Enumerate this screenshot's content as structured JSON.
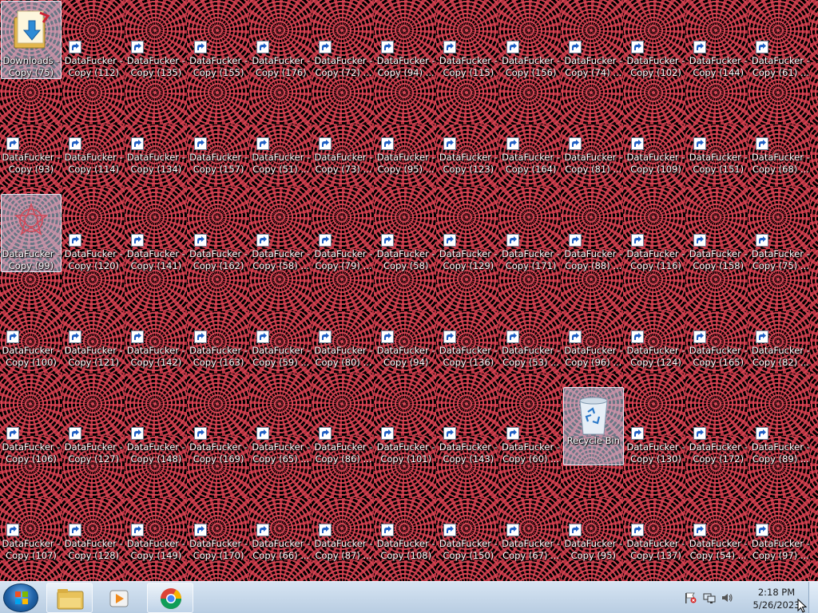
{
  "desktop": {
    "rows": [
      [
        "Downloads - Copy (75)",
        "DataFucker - Copy (112)",
        "DataFucker - Copy (135)",
        "DataFucker - Copy (155)",
        "DataFucker - Copy (176)",
        "DataFucker - Copy (72) ...",
        "DataFucker - Copy (94) ...",
        "DataFucker - Copy (115)",
        "DataFucker - Copy (156)",
        "DataFucker - Copy (74) ...",
        "DataFucker - Copy (102)",
        "DataFucker - Copy (144)",
        "DataFucker - Copy (61) ..."
      ],
      [
        "DataFucker - Copy (93)",
        "DataFucker - Copy (114)",
        "DataFucker - Copy (134)",
        "DataFucker - Copy (157)",
        "DataFucker - Copy (51) ...",
        "DataFucker - Copy (73) ...",
        "DataFucker - Copy (95) ...",
        "DataFucker - Copy (123)",
        "DataFucker - Copy (164)",
        "DataFucker - Copy (81) ...",
        "DataFucker - Copy (109)",
        "DataFucker - Copy (151)",
        "DataFucker - Copy (68) ..."
      ],
      [
        "DataFucker - Copy (99)",
        "DataFucker - Copy (120)",
        "DataFucker - Copy (141)",
        "DataFucker - Copy (162)",
        "DataFucker - Copy (58) ...",
        "DataFucker - Copy (79) ...",
        "DataFucker - Copy (58)",
        "DataFucker - Copy (129)",
        "DataFucker - Copy (171)",
        "DataFucker - Copy (88) ...",
        "DataFucker - Copy (116)",
        "DataFucker - Copy (158)",
        "DataFucker - Copy (75) ..."
      ],
      [
        "DataFucker - Copy (100)",
        "DataFucker - Copy (121)",
        "DataFucker - Copy (142)",
        "DataFucker - Copy (163)",
        "DataFucker - Copy (59) ...",
        "DataFucker - Copy (80) ...",
        "DataFucker - Copy (94)",
        "DataFucker - Copy (136)",
        "DataFucker - Copy (53) ...",
        "DataFucker - Copy (96) ...",
        "DataFucker - Copy (124)",
        "DataFucker - Copy (165)",
        "DataFucker - Copy (82) ..."
      ],
      [
        "DataFucker - Copy (106)",
        "DataFucker - Copy (127)",
        "DataFucker - Copy (148)",
        "DataFucker - Copy (169)",
        "DataFucker - Copy (65) ...",
        "DataFucker - Copy (86) ...",
        "DataFucker - Copy (101)",
        "DataFucker - Copy (143)",
        "DataFucker - Copy (60) ...",
        "Recycle Bin",
        "DataFucker - Copy (130)",
        "DataFucker - Copy (172)",
        "DataFucker - Copy (89) ..."
      ],
      [
        "DataFucker - Copy (107)",
        "DataFucker - Copy (128)",
        "DataFucker - Copy (149)",
        "DataFucker - Copy (170)",
        "DataFucker - Copy (66) ...",
        "DataFucker - Copy (87) ...",
        "DataFucker - Copy (108)",
        "DataFucker - Copy (150)",
        "DataFucker - Copy (67) ...",
        "DataFucker - Copy (95)",
        "DataFucker - Copy (137)",
        "DataFucker - Copy (54) ...",
        "DataFucker - Copy (97) ..."
      ]
    ]
  },
  "taskbar": {
    "clock_time": "2:18 PM",
    "clock_date": "5/26/2023",
    "accent": "#2163a8"
  }
}
